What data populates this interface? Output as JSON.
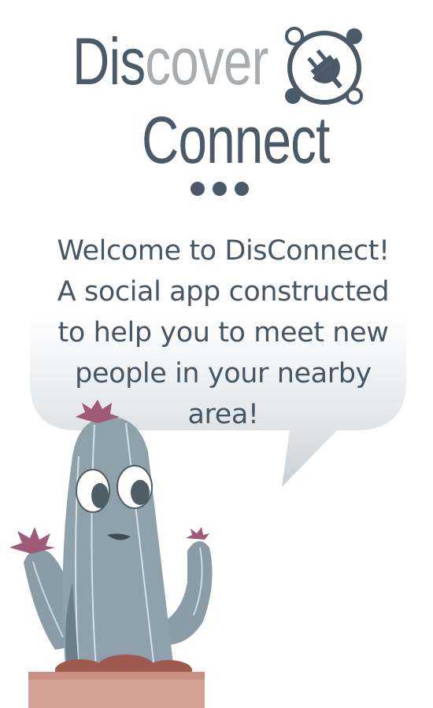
{
  "logo": {
    "dis": "Dis",
    "cover": "cover",
    "connect": "Connect",
    "icon": "plug-icon",
    "colors": {
      "dark": "#4a5a68",
      "light": "#a9adb0"
    }
  },
  "welcome": {
    "lines": [
      "Welcome to DisConnect!",
      "A social app constructed",
      "to help you to meet new",
      "people in your nearby",
      "area!"
    ]
  },
  "mascot": {
    "icon": "cactus-mascot-icon"
  }
}
